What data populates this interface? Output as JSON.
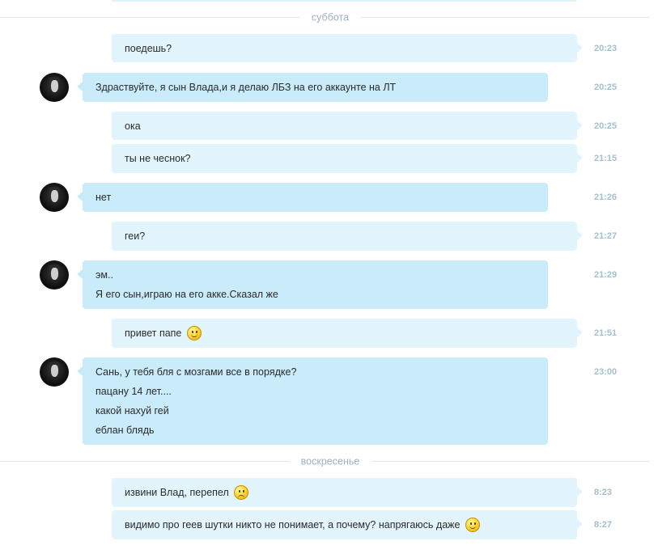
{
  "separators": {
    "saturday": "суббота",
    "sunday": "воскресенье"
  },
  "messages": [
    {
      "lines": [
        "поедешь?"
      ],
      "time": "20:23"
    },
    {
      "lines": [
        "Здраствуйте, я сын Влада,и я делаю ЛБЗ на его аккаунте на ЛТ"
      ],
      "time": "20:25"
    },
    {
      "lines": [
        "ока"
      ],
      "time": "20:25"
    },
    {
      "lines": [
        "ты не чеснок?"
      ],
      "time": "21:15"
    },
    {
      "lines": [
        "нет"
      ],
      "time": "21:26"
    },
    {
      "lines": [
        "геи?"
      ],
      "time": "21:27"
    },
    {
      "lines": [
        "эм..",
        "Я его сын,играю на его акке.Сказал же"
      ],
      "time": "21:29"
    },
    {
      "lines": [
        "привет папе"
      ],
      "time": "21:51"
    },
    {
      "lines": [
        "Сань, у тебя бля с мозгами все в порядке?",
        "пацану 14 лет....",
        "какой нахуй гей",
        "еблан блядь"
      ],
      "time": "23:00"
    },
    {
      "lines": [
        "извини Влад, перепел"
      ],
      "time": "8:23"
    },
    {
      "lines": [
        "видимо про геев шутки никто не понимает, а почему? напрягаюсь даже"
      ],
      "time": "8:27"
    }
  ],
  "icons": {
    "smile": "smile-emoji-icon",
    "sad": "sad-emoji-icon",
    "avatar": "contact-avatar"
  },
  "colors": {
    "outgoing_bubble": "#e2f4fc",
    "incoming_bubble": "#c9ebfa",
    "timestamp": "#a3c0cc",
    "separator_text": "#9cb2bd"
  }
}
